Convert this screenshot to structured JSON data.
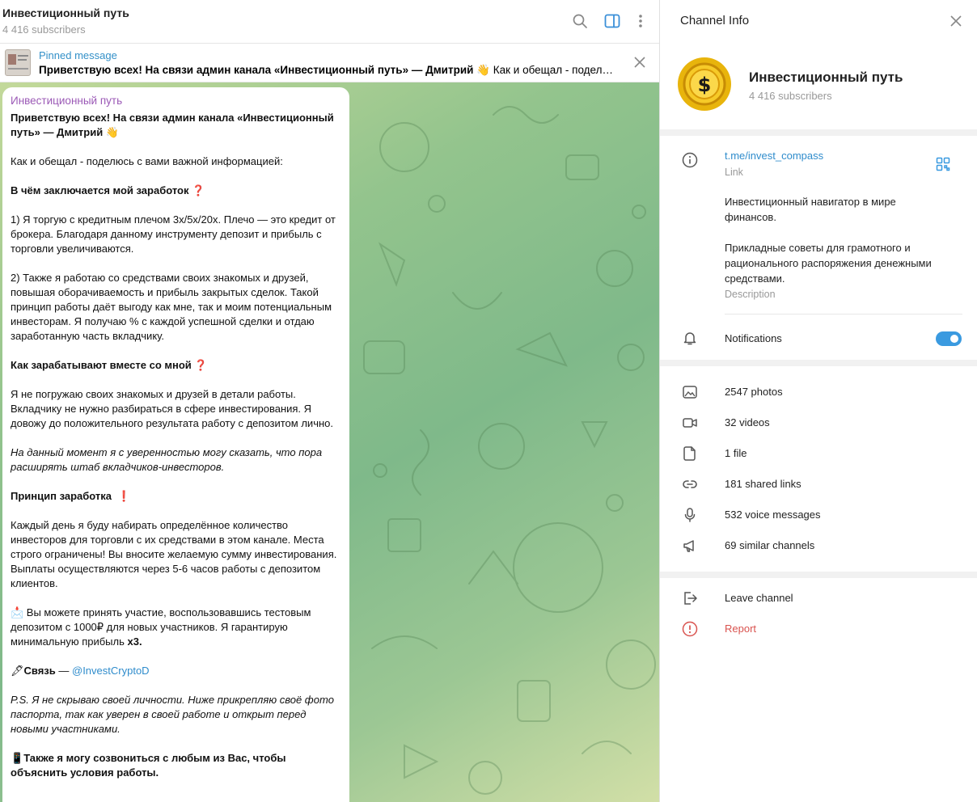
{
  "chat": {
    "title": "Инвестиционный путь",
    "subscribers": "4 416 subscribers",
    "icons": {
      "search": "search-icon",
      "sidebar": "sidebar-toggle-icon",
      "more": "more-vertical-icon"
    }
  },
  "pinned": {
    "label": "Pinned message",
    "text_bold": "Приветствую всех! На связи админ канала «Инвестиционный путь» — Дмитрий 👋",
    "text_rest": " Как и обещал - поделюсь с вами важной информацией:"
  },
  "message": {
    "author": "Инвестиционный путь",
    "greeting": "Приветствую всех! На связи админ канала «Инвестиционный путь» — Дмитрий 👋",
    "intro": "Как и обещал - поделюсь с вами важной информацией:",
    "h1": "В чём заключается мой заработок",
    "h1_mark": "❓",
    "p1": "1) Я торгую с кредитным плечом 3х/5х/20х. Плечо — это кредит от брокера. Благодаря данному инструменту депозит и прибыль с торговли увеличиваются.",
    "p2": "2) Также я работаю со средствами своих знакомых и друзей, повышая оборачиваемость и прибыль закрытых сделок. Такой принцип работы даёт выгоду как мне, так и моим потенциальным инвесторам. Я получаю % с каждой успешной сделки и отдаю заработанную часть вкладчику.",
    "h2": "Как зарабатывают вместе со мной",
    "h2_mark": "❓",
    "p3": "Я не погружаю своих знакомых и друзей в детали работы. Вкладчику не нужно разбираться в сфере инвестирования. Я довожу до положительного результата работу с депозитом лично.",
    "p4": "На данный момент я с уверенностью могу сказать, что пора расширять штаб вкладчиков-инвесторов.",
    "h3": "Принцип заработка",
    "h3_mark": "❗",
    "p5": "Каждый день я буду набирать определённое количество инвесторов для торговли с их средствами в этом канале. Места строго ограничены! Вы вносите желаемую сумму инвестирования. Выплаты осуществляются через 5-6 часов работы с депозитом клиентов.",
    "p6_emoji": "📩",
    "p6": " Вы можете принять участие, воспользовавшись тестовым депозитом с 1000₽ для новых участников. Я гарантирую минимальную прибыль ",
    "p6_bold": "x3.",
    "contact_emoji": "🖋",
    "contact_label": "Связь",
    "contact_dash": " — ",
    "contact_link": "@InvestCryptoD",
    "p7": "P.S. Я не скрываю своей личности. Ниже прикрепляю своё фото паспорта, так как уверен в своей работе и открыт перед новыми участниками.",
    "p8_emoji": "📱",
    "p8": "Также я могу созвониться с любым из Вас, чтобы объяснить условия работы."
  },
  "info": {
    "title": "Channel Info",
    "channel_name": "Инвестиционный путь",
    "subscribers": "4 416 subscribers",
    "avatar_color": "#e8b40c",
    "link": "t.me/invest_compass",
    "link_caption": "Link",
    "desc_line1": "Инвестиционный навигатор в мире финансов.",
    "desc_line2": "Прикладные советы для грамотного и рационального распоряжения денежными средствами.",
    "desc_caption": "Description",
    "notifications": "Notifications",
    "notifications_on": true,
    "media": [
      {
        "label": "2547 photos",
        "icon": "photo-icon"
      },
      {
        "label": "32 videos",
        "icon": "video-icon"
      },
      {
        "label": "1 file",
        "icon": "file-icon"
      },
      {
        "label": "181 shared links",
        "icon": "link-icon"
      },
      {
        "label": "532 voice messages",
        "icon": "microphone-icon"
      },
      {
        "label": "69 similar channels",
        "icon": "megaphone-icon"
      }
    ],
    "leave": "Leave channel",
    "report": "Report",
    "colors": {
      "accent": "#3a9ae0",
      "link": "#2f8ccc",
      "danger": "#d9534f",
      "author": "#9b59b6"
    }
  }
}
